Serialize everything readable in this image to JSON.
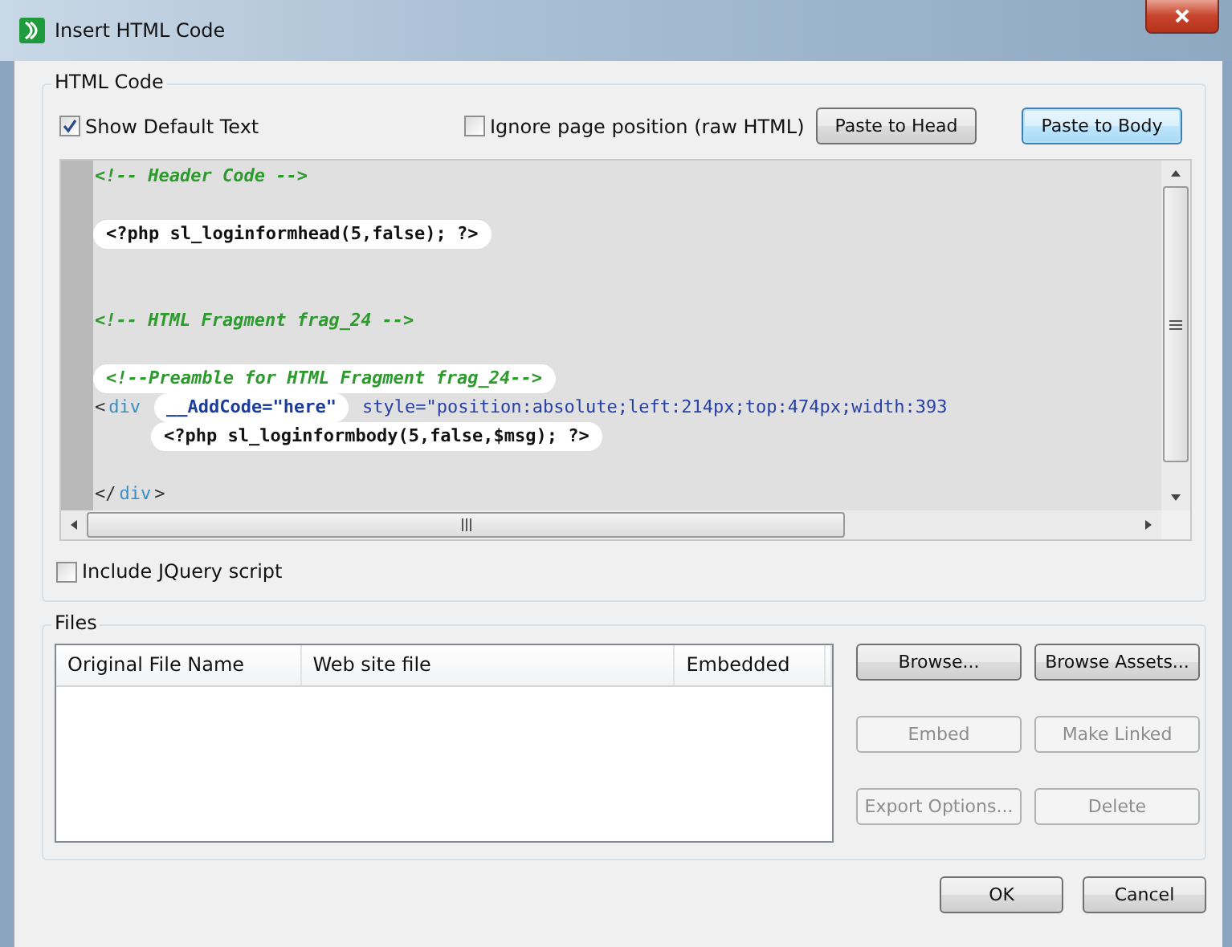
{
  "window": {
    "title": "Insert HTML Code"
  },
  "html_code": {
    "title": "HTML Code",
    "options": [
      {
        "label": "Show Default Text",
        "checked": true
      },
      {
        "label": "Ignore page position (raw HTML)",
        "checked": false
      }
    ],
    "buttons": [
      {
        "label": "Paste to Head",
        "focused": false
      },
      {
        "label": "Paste to Body",
        "focused": true
      }
    ],
    "code_lines": [
      {
        "kind": "code",
        "tokens": [
          {
            "text": "<!-- Header Code -->",
            "kind": "comment",
            "highlighted": false
          }
        ]
      },
      {
        "kind": "blank"
      },
      {
        "kind": "code",
        "tokens": [
          {
            "text": "<?php sl_loginformhead(5,false); ?>",
            "kind": "php",
            "highlighted": true
          }
        ]
      },
      {
        "kind": "blank"
      },
      {
        "kind": "blank"
      },
      {
        "kind": "code",
        "tokens": [
          {
            "text": "<!-- HTML Fragment frag_24 -->",
            "kind": "comment",
            "highlighted": false
          }
        ]
      },
      {
        "kind": "blank"
      },
      {
        "kind": "code",
        "tokens": [
          {
            "text": "<!--Preamble for HTML Fragment frag_24-->",
            "kind": "comment",
            "highlighted": true
          }
        ]
      },
      {
        "kind": "code",
        "tokens": [
          {
            "text": "<",
            "kind": "punct",
            "highlighted": false
          },
          {
            "text": "div",
            "kind": "tag",
            "highlighted": false
          },
          {
            "text": "__AddCode=\"here\"",
            "kind": "custom",
            "highlighted": true
          },
          {
            "text": "style=\"position:absolute;left:214px;top:474px;width:393",
            "kind": "attr",
            "highlighted": false
          }
        ]
      },
      {
        "kind": "indented",
        "tokens": [
          {
            "text": "<?php sl_loginformbody(5,false,$msg); ?>",
            "kind": "php",
            "highlighted": true
          }
        ]
      },
      {
        "kind": "blank"
      },
      {
        "kind": "code",
        "tokens": [
          {
            "text": "</",
            "kind": "punct",
            "highlighted": false
          },
          {
            "text": "div",
            "kind": "tag",
            "highlighted": false
          },
          {
            "text": ">",
            "kind": "punct",
            "highlighted": false
          }
        ]
      }
    ],
    "jquery": {
      "label": "Include JQuery script",
      "checked": false
    }
  },
  "files": {
    "title": "Files",
    "columns": [
      "Original File Name",
      "Web site file",
      "Embedded"
    ],
    "buttons": [
      {
        "label": "Browse...",
        "disabled": false
      },
      {
        "label": "Browse Assets...",
        "disabled": false
      },
      {
        "label": "Embed",
        "disabled": true
      },
      {
        "label": "Make Linked",
        "disabled": true
      },
      {
        "label": "Export Options...",
        "disabled": true
      },
      {
        "label": "Delete",
        "disabled": true
      }
    ]
  },
  "footer_buttons": [
    {
      "label": "OK"
    },
    {
      "label": "Cancel"
    }
  ]
}
